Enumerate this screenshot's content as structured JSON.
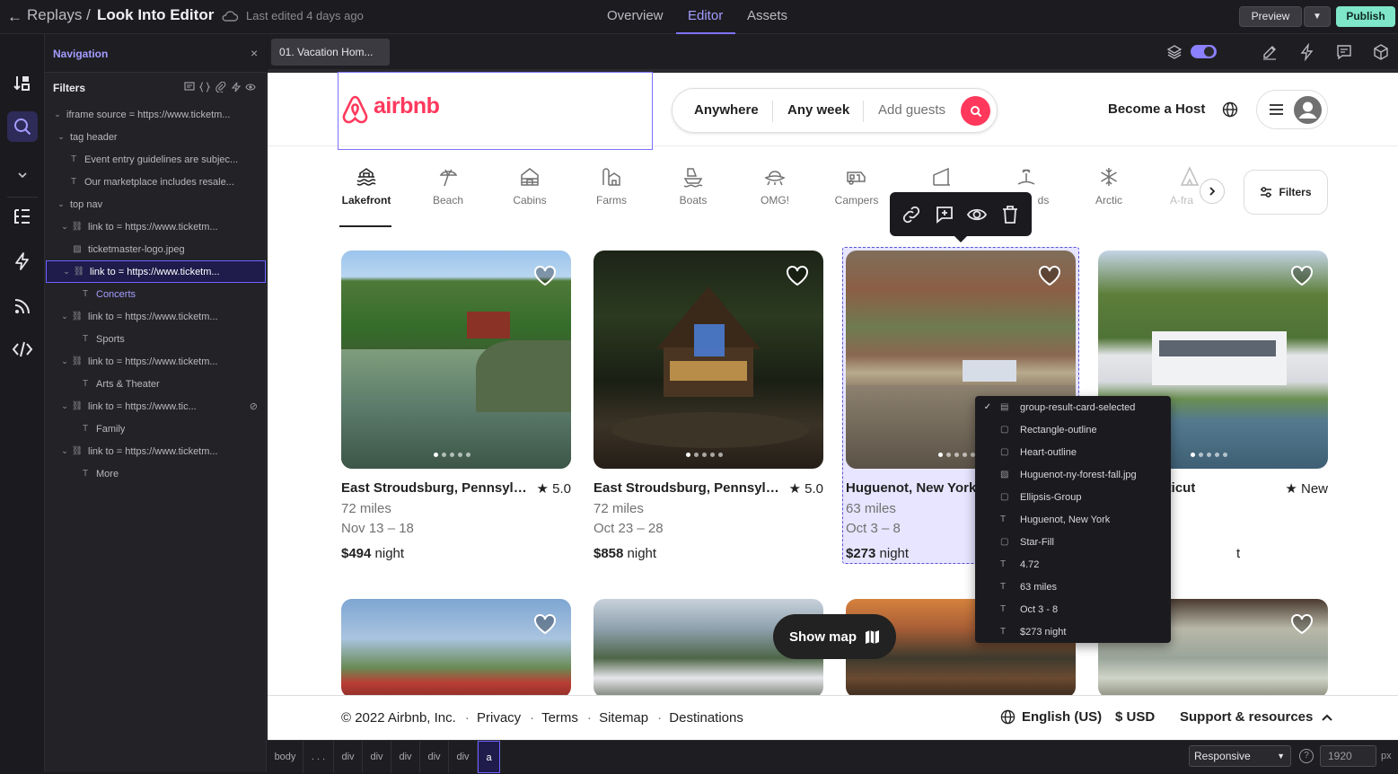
{
  "topbar": {
    "back_label": "Replays",
    "separator": "/",
    "title": "Look Into Editor",
    "edited": "Last edited 4 days ago",
    "tabs": [
      "Overview",
      "Editor",
      "Assets"
    ],
    "preview": "Preview",
    "publish": "Publish"
  },
  "nav": {
    "title": "Navigation",
    "filters": "Filters",
    "tree": [
      {
        "label": "iframe source = https://www.ticketm...",
        "icon": "chevron",
        "depth": 0
      },
      {
        "label": "tag header",
        "icon": "chevron",
        "depth": 1
      },
      {
        "label": "Event entry guidelines are subjec...",
        "icon": "T",
        "depth": 1
      },
      {
        "label": "Our marketplace includes resale...",
        "icon": "T",
        "depth": 1
      },
      {
        "label": "top nav",
        "icon": "chevron",
        "depth": 1
      },
      {
        "label": "link to = https://www.ticketm...",
        "icon": "link",
        "depth": 2
      },
      {
        "label": "ticketmaster-logo.jpeg",
        "icon": "image",
        "depth": 2
      },
      {
        "label": "link to = https://www.ticketm...",
        "icon": "link",
        "depth": 2,
        "selected": true
      },
      {
        "label": "Concerts",
        "icon": "T",
        "depth": 3,
        "highlight": true
      },
      {
        "label": "link to = https://www.ticketm...",
        "icon": "link",
        "depth": 2
      },
      {
        "label": "Sports",
        "icon": "T",
        "depth": 3
      },
      {
        "label": "link to = https://www.ticketm...",
        "icon": "link",
        "depth": 2
      },
      {
        "label": "Arts & Theater",
        "icon": "T",
        "depth": 3
      },
      {
        "label": "link to = https://www.tic...",
        "icon": "link",
        "depth": 2,
        "hidden": true
      },
      {
        "label": "Family",
        "icon": "T",
        "depth": 3
      },
      {
        "label": "link to = https://www.ticketm...",
        "icon": "link",
        "depth": 2
      },
      {
        "label": "More",
        "icon": "T",
        "depth": 3
      }
    ]
  },
  "doc_tab": "01. Vacation Hom...",
  "airbnb": {
    "logo": "airbnb",
    "search": {
      "where": "Anywhere",
      "when": "Any week",
      "who": "Add guests"
    },
    "become_host": "Become a Host",
    "categories": [
      "Lakefront",
      "Beach",
      "Cabins",
      "Farms",
      "Boats",
      "OMG!",
      "Campers",
      "",
      "ds",
      "Arctic",
      "A-fra"
    ],
    "filters": "Filters",
    "cards": [
      {
        "loc": "East Stroudsburg, Pennsylv...",
        "rating": "★ 5.0",
        "dist": "72 miles",
        "dates": "Nov 13 – 18",
        "price": "$494",
        "per": " night"
      },
      {
        "loc": "East Stroudsburg, Pennsylv...",
        "rating": "★ 5.0",
        "dist": "72 miles",
        "dates": "Oct 23 – 28",
        "price": "$858",
        "per": " night"
      },
      {
        "loc": "Huguenot, New York",
        "rating": "",
        "dist": "63 miles",
        "dates": "Oct 3 – 8",
        "price": "$273",
        "per": " night"
      },
      {
        "loc": "ld, Connecticut",
        "rating": "★ New",
        "dist": "",
        "dates": "",
        "price": "",
        "per": "t"
      }
    ],
    "show_map": "Show map",
    "footer": {
      "copyright": "© 2022 Airbnb, Inc.",
      "links": [
        "Privacy",
        "Terms",
        "Sitemap",
        "Destinations"
      ],
      "language": "English (US)",
      "currency": "$ USD",
      "support": "Support & resources"
    }
  },
  "layer_menu": [
    {
      "label": "group-result-card-selected",
      "icon": "group",
      "checked": true
    },
    {
      "label": "Rectangle-outline",
      "icon": "rect"
    },
    {
      "label": "Heart-outline",
      "icon": "rect"
    },
    {
      "label": "Huguenot-ny-forest-fall.jpg",
      "icon": "image"
    },
    {
      "label": "Ellipsis-Group",
      "icon": "rect"
    },
    {
      "label": "Huguenot, New York",
      "icon": "T"
    },
    {
      "label": "Star-Fill",
      "icon": "rect"
    },
    {
      "label": "4.72",
      "icon": "T"
    },
    {
      "label": "63 miles",
      "icon": "T"
    },
    {
      "label": "Oct 3 - 8",
      "icon": "T"
    },
    {
      "label": "$273 night",
      "icon": "T"
    }
  ],
  "bottombar": {
    "crumbs": [
      "body",
      ". . .",
      "div",
      "div",
      "div",
      "div",
      "div",
      "a"
    ],
    "responsive": "Responsive",
    "width": "1920",
    "unit": "px"
  },
  "colors": {
    "accent": "#7f73ff",
    "publish": "#7fe6c9",
    "airbnb": "#ff385c"
  }
}
